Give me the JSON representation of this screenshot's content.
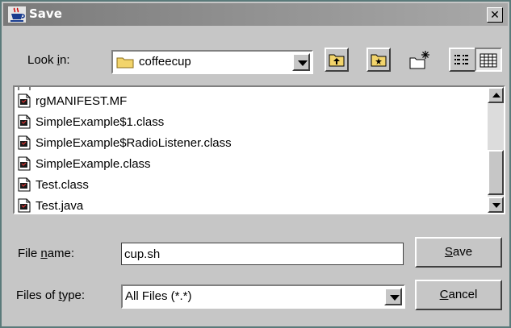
{
  "window": {
    "title": "Save",
    "close_glyph": "✕"
  },
  "look_in": {
    "label_pre": "Look ",
    "label_mn": "i",
    "label_post": "n:",
    "value": "coffeecup"
  },
  "toolbar": {
    "icons": [
      "up-one-level-icon",
      "home-icon",
      "new-folder-icon",
      "list-view-icon",
      "details-view-icon"
    ]
  },
  "files": [
    {
      "name": "rgMANIFEST.MF"
    },
    {
      "name": "SimpleExample$1.class"
    },
    {
      "name": "SimpleExample$RadioListener.class"
    },
    {
      "name": "SimpleExample.class"
    },
    {
      "name": "Test.class"
    },
    {
      "name": "Test.java"
    }
  ],
  "file_name": {
    "label_pre": "File ",
    "label_mn": "n",
    "label_post": "ame:",
    "value": "cup.sh"
  },
  "files_of_type": {
    "label_pre": "Files of ",
    "label_mn": "t",
    "label_post": "ype:",
    "value": "All Files (*.*)"
  },
  "buttons": {
    "save_mn": "S",
    "save_rest": "ave",
    "cancel_mn": "C",
    "cancel_rest": "ancel"
  },
  "colors": {
    "titlebar_start": "#7a7a7a",
    "titlebar_end": "#a9a9a9",
    "panel": "#c6c6c6",
    "folder": "#f2d46b"
  }
}
